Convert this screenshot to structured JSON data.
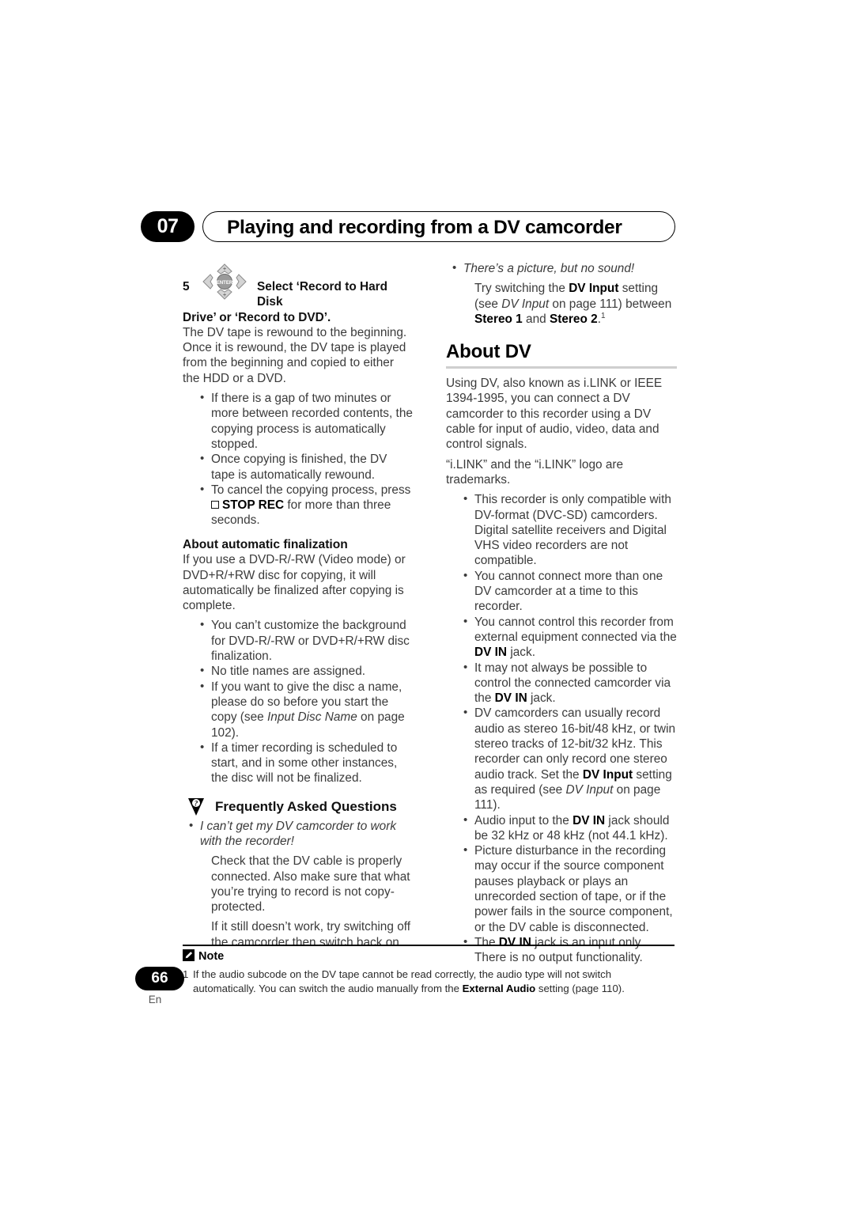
{
  "header": {
    "chapter_number": "07",
    "chapter_title": "Playing and recording from a DV camcorder"
  },
  "left_column": {
    "step": {
      "number": "5",
      "icon": "dpad-enter-icon",
      "label_line1": "Select ‘Record to Hard Disk",
      "label_line2": "Drive’ or ‘Record to DVD’."
    },
    "step_body": "The DV tape is rewound to the beginning. Once it is rewound, the DV tape is played from the beginning and copied to either the HDD or a DVD.",
    "step_bullets": [
      "If there is a gap of two minutes or more between recorded contents, the copying process is automatically stopped.",
      "Once copying is finished, the DV tape is automatically rewound.",
      "To cancel the copying process, press"
    ],
    "stop_rec_bullet": {
      "lead": "To cancel the copying process, press",
      "symbol": "stop-square-icon",
      "button": "STOP REC",
      "tail": "for more than three seconds."
    },
    "finalization": {
      "heading": "About automatic finalization",
      "body": "If you use a DVD-R/-RW (Video mode) or DVD+R/+RW disc for copying, it will automatically be finalized after copying is complete.",
      "bullets": [
        "You can’t customize the background for DVD-R/-RW or DVD+R/+RW disc finalization.",
        "No title names are assigned."
      ],
      "bullet_disc_name": {
        "pre": "If you want to give the disc a name, please do so before you start the copy (see ",
        "italic": "Input Disc Name",
        "post": " on page 102)."
      },
      "bullet_timer": "If a timer recording is scheduled to start, and in some other instances, the disc will not be finalized."
    },
    "faq": {
      "icon": "faq-question-icon",
      "heading": "Frequently Asked Questions",
      "question": "I can’t get my DV camcorder to work with the recorder!",
      "answer_1": "Check that the DV cable is properly connected. Also make sure that what you’re trying to record is not copy-protected.",
      "answer_2": "If it still doesn’t work, try switching off the camcorder then switch back on."
    }
  },
  "right_column": {
    "faq_continued": {
      "question": "There’s a picture, but no sound!",
      "answer_parts": {
        "p1": "Try switching the ",
        "b1": "DV Input",
        "p2": " setting (see ",
        "i1": "DV Input",
        "p3": " on page 111) between ",
        "b2": "Stereo 1",
        "p4": " and ",
        "b3": "Stereo 2",
        "p5": ".",
        "footnote_ref": "1"
      }
    },
    "about_dv": {
      "heading": "About DV",
      "para_1": "Using DV, also known as i.LINK or IEEE 1394-1995, you can connect a DV camcorder to this recorder using a DV cable for input of audio, video, data and control signals.",
      "para_2": "“i.LINK” and the “i.LINK” logo are trademarks.",
      "bullets": [
        "This recorder is only compatible with DV-format (DVC-SD) camcorders. Digital satellite receivers and Digital VHS video recorders are not compatible.",
        "You cannot connect more than one DV camcorder at a time to this recorder."
      ],
      "bullet_control": {
        "pre": "You cannot control this recorder from external equipment connected via the ",
        "bold": "DV IN",
        "post": " jack."
      },
      "bullet_maynot": {
        "pre": "It may not always be possible to control the connected camcorder via the ",
        "bold": "DV IN",
        "post": " jack."
      },
      "bullet_audio": {
        "p1": "DV camcorders can usually record audio as stereo 16-bit/48 kHz, or twin stereo tracks of 12-bit/32 kHz. This recorder can only record one stereo audio track. Set the ",
        "b1": "DV Input",
        "p2": " setting as required (see ",
        "i1": "DV Input",
        "p3": " on page 111)."
      },
      "bullet_audioinput": {
        "pre": "Audio input to the ",
        "bold": "DV IN",
        "post": " jack should be 32 kHz or 48 kHz (not 44.1 kHz)."
      },
      "bullet_disturbance": "Picture disturbance in the recording may occur if the source component pauses playback or plays an unrecorded section of tape, or if the power fails in the source component, or the DV cable is disconnected.",
      "bullet_inputonly": {
        "pre": "The ",
        "bold": "DV IN",
        "post": " jack is an input only. There is no output functionality."
      }
    }
  },
  "footer": {
    "note_icon": "pencil-note-icon",
    "note_label": "Note",
    "footnote_number": "1",
    "footnote_part1": "If the audio subcode on the DV tape cannot be read correctly, the audio type will not switch automatically. You can switch the audio manually from the ",
    "footnote_bold": "External Audio",
    "footnote_part2": " setting (page 110).",
    "page_number": "66",
    "language": "En"
  }
}
